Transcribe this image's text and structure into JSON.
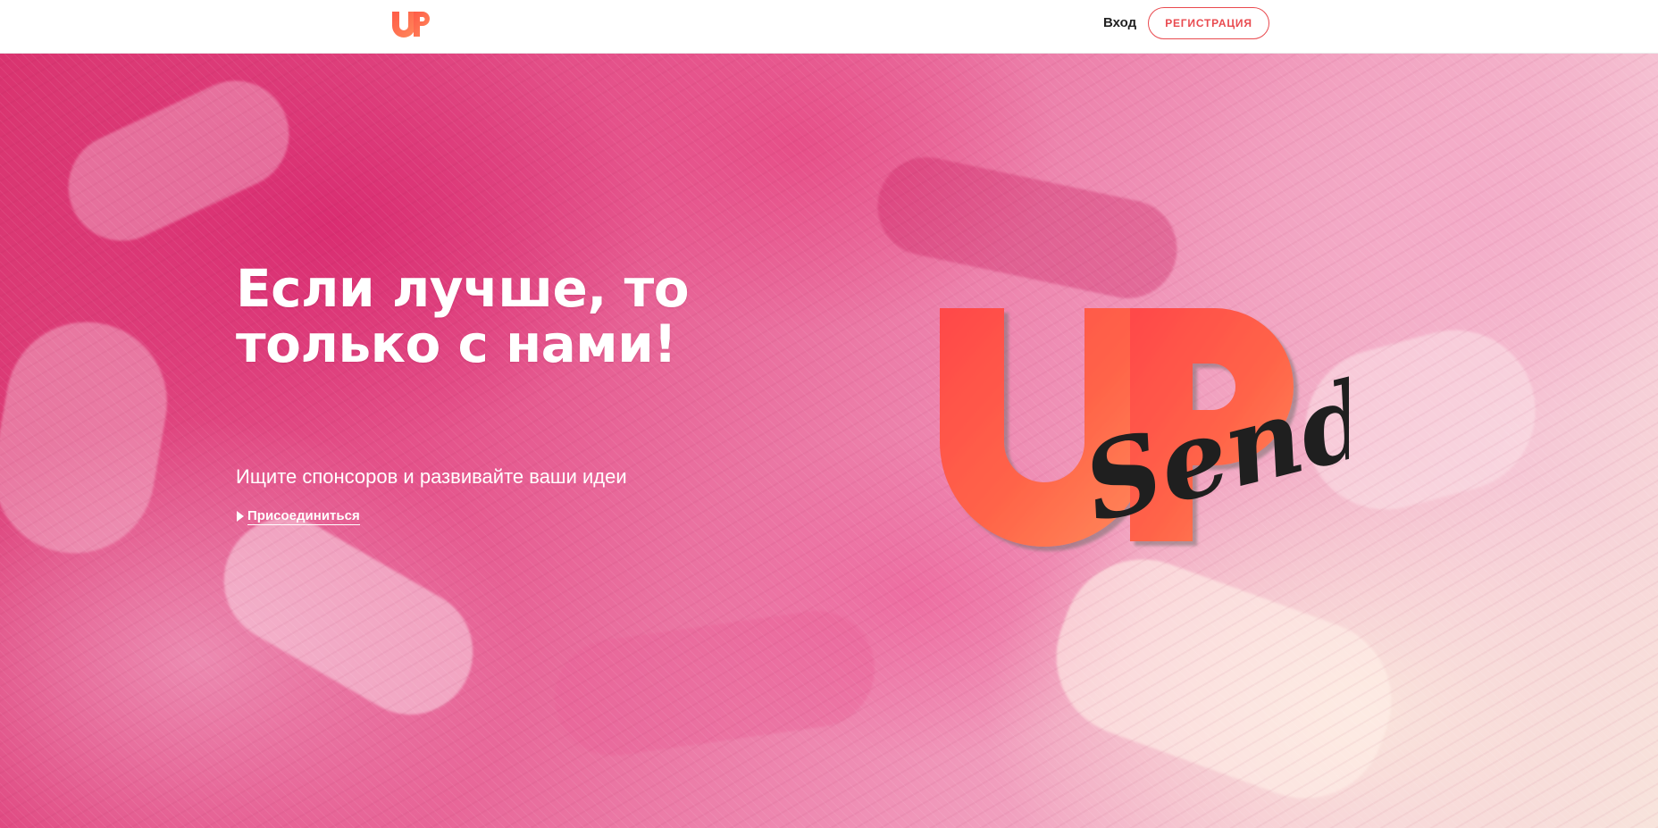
{
  "header": {
    "logo_icon": "up-logo-icon",
    "login_label": "Вход",
    "register_label": "РЕГИСТРАЦИЯ"
  },
  "hero": {
    "title_line1": "Если лучше, то",
    "title_line2": "только с нами!",
    "subtitle": "Ищите спонсоров и развивайте ваши идеи",
    "cta_label": "Присоединиться",
    "logo_text_up": "UP",
    "logo_text_send": "Send"
  },
  "colors": {
    "accent": "#e94a4f",
    "logo_orange": "#ff6a45",
    "hero_pink": "#e0437c"
  }
}
